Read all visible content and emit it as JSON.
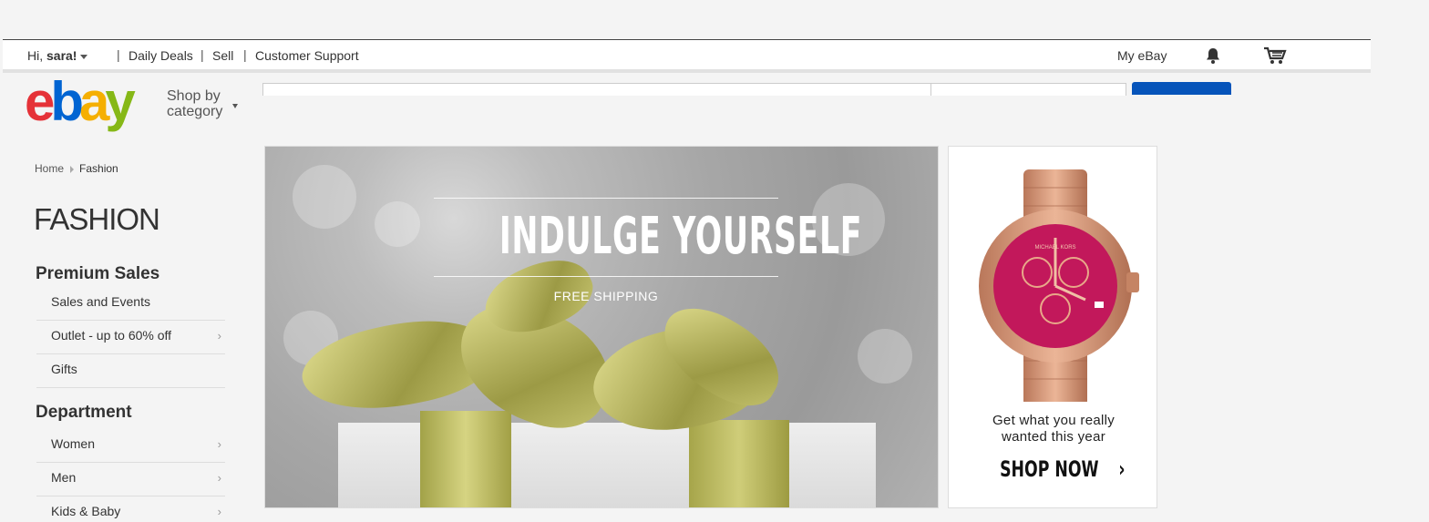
{
  "header": {
    "greeting_prefix": "Hi, ",
    "user_name": "sara!",
    "links": [
      "Daily Deals",
      "Sell",
      "Customer Support"
    ],
    "my_ebay": "My eBay",
    "notification_icon": "bell-icon",
    "cart_icon": "cart-icon"
  },
  "brand": {
    "logo_letters": [
      "e",
      "b",
      "a",
      "y"
    ],
    "colors": {
      "e": "#e53238",
      "b": "#0064d2",
      "a": "#f5af02",
      "y": "#86b817"
    },
    "shop_by_line1": "Shop by",
    "shop_by_line2": "category"
  },
  "breadcrumb": {
    "home": "Home",
    "current": "Fashion"
  },
  "page_title": "FASHION",
  "sidebar": {
    "premium": {
      "title": "Premium Sales",
      "items": [
        {
          "label": "Sales and Events",
          "chevron": false
        },
        {
          "label": "Outlet - up to 60% off",
          "chevron": true
        },
        {
          "label": "Gifts",
          "chevron": false
        }
      ]
    },
    "department": {
      "title": "Department",
      "items": [
        {
          "label": "Women",
          "chevron": true
        },
        {
          "label": "Men",
          "chevron": true
        },
        {
          "label": "Kids & Baby",
          "chevron": true
        }
      ]
    },
    "chevron_glyph": "›"
  },
  "hero": {
    "headline": "INDULGE YOURSELF",
    "subline": "FREE SHIPPING"
  },
  "promo": {
    "line1": "Get what you really",
    "line2": "wanted this year",
    "cta": "SHOP NOW",
    "cta_arrow": "›",
    "watch_brand_text": "MICHAEL KORS",
    "colors": {
      "dial": "#c2185b",
      "case": "#d9956d"
    }
  },
  "colors": {
    "search_button": "#0654ba"
  }
}
